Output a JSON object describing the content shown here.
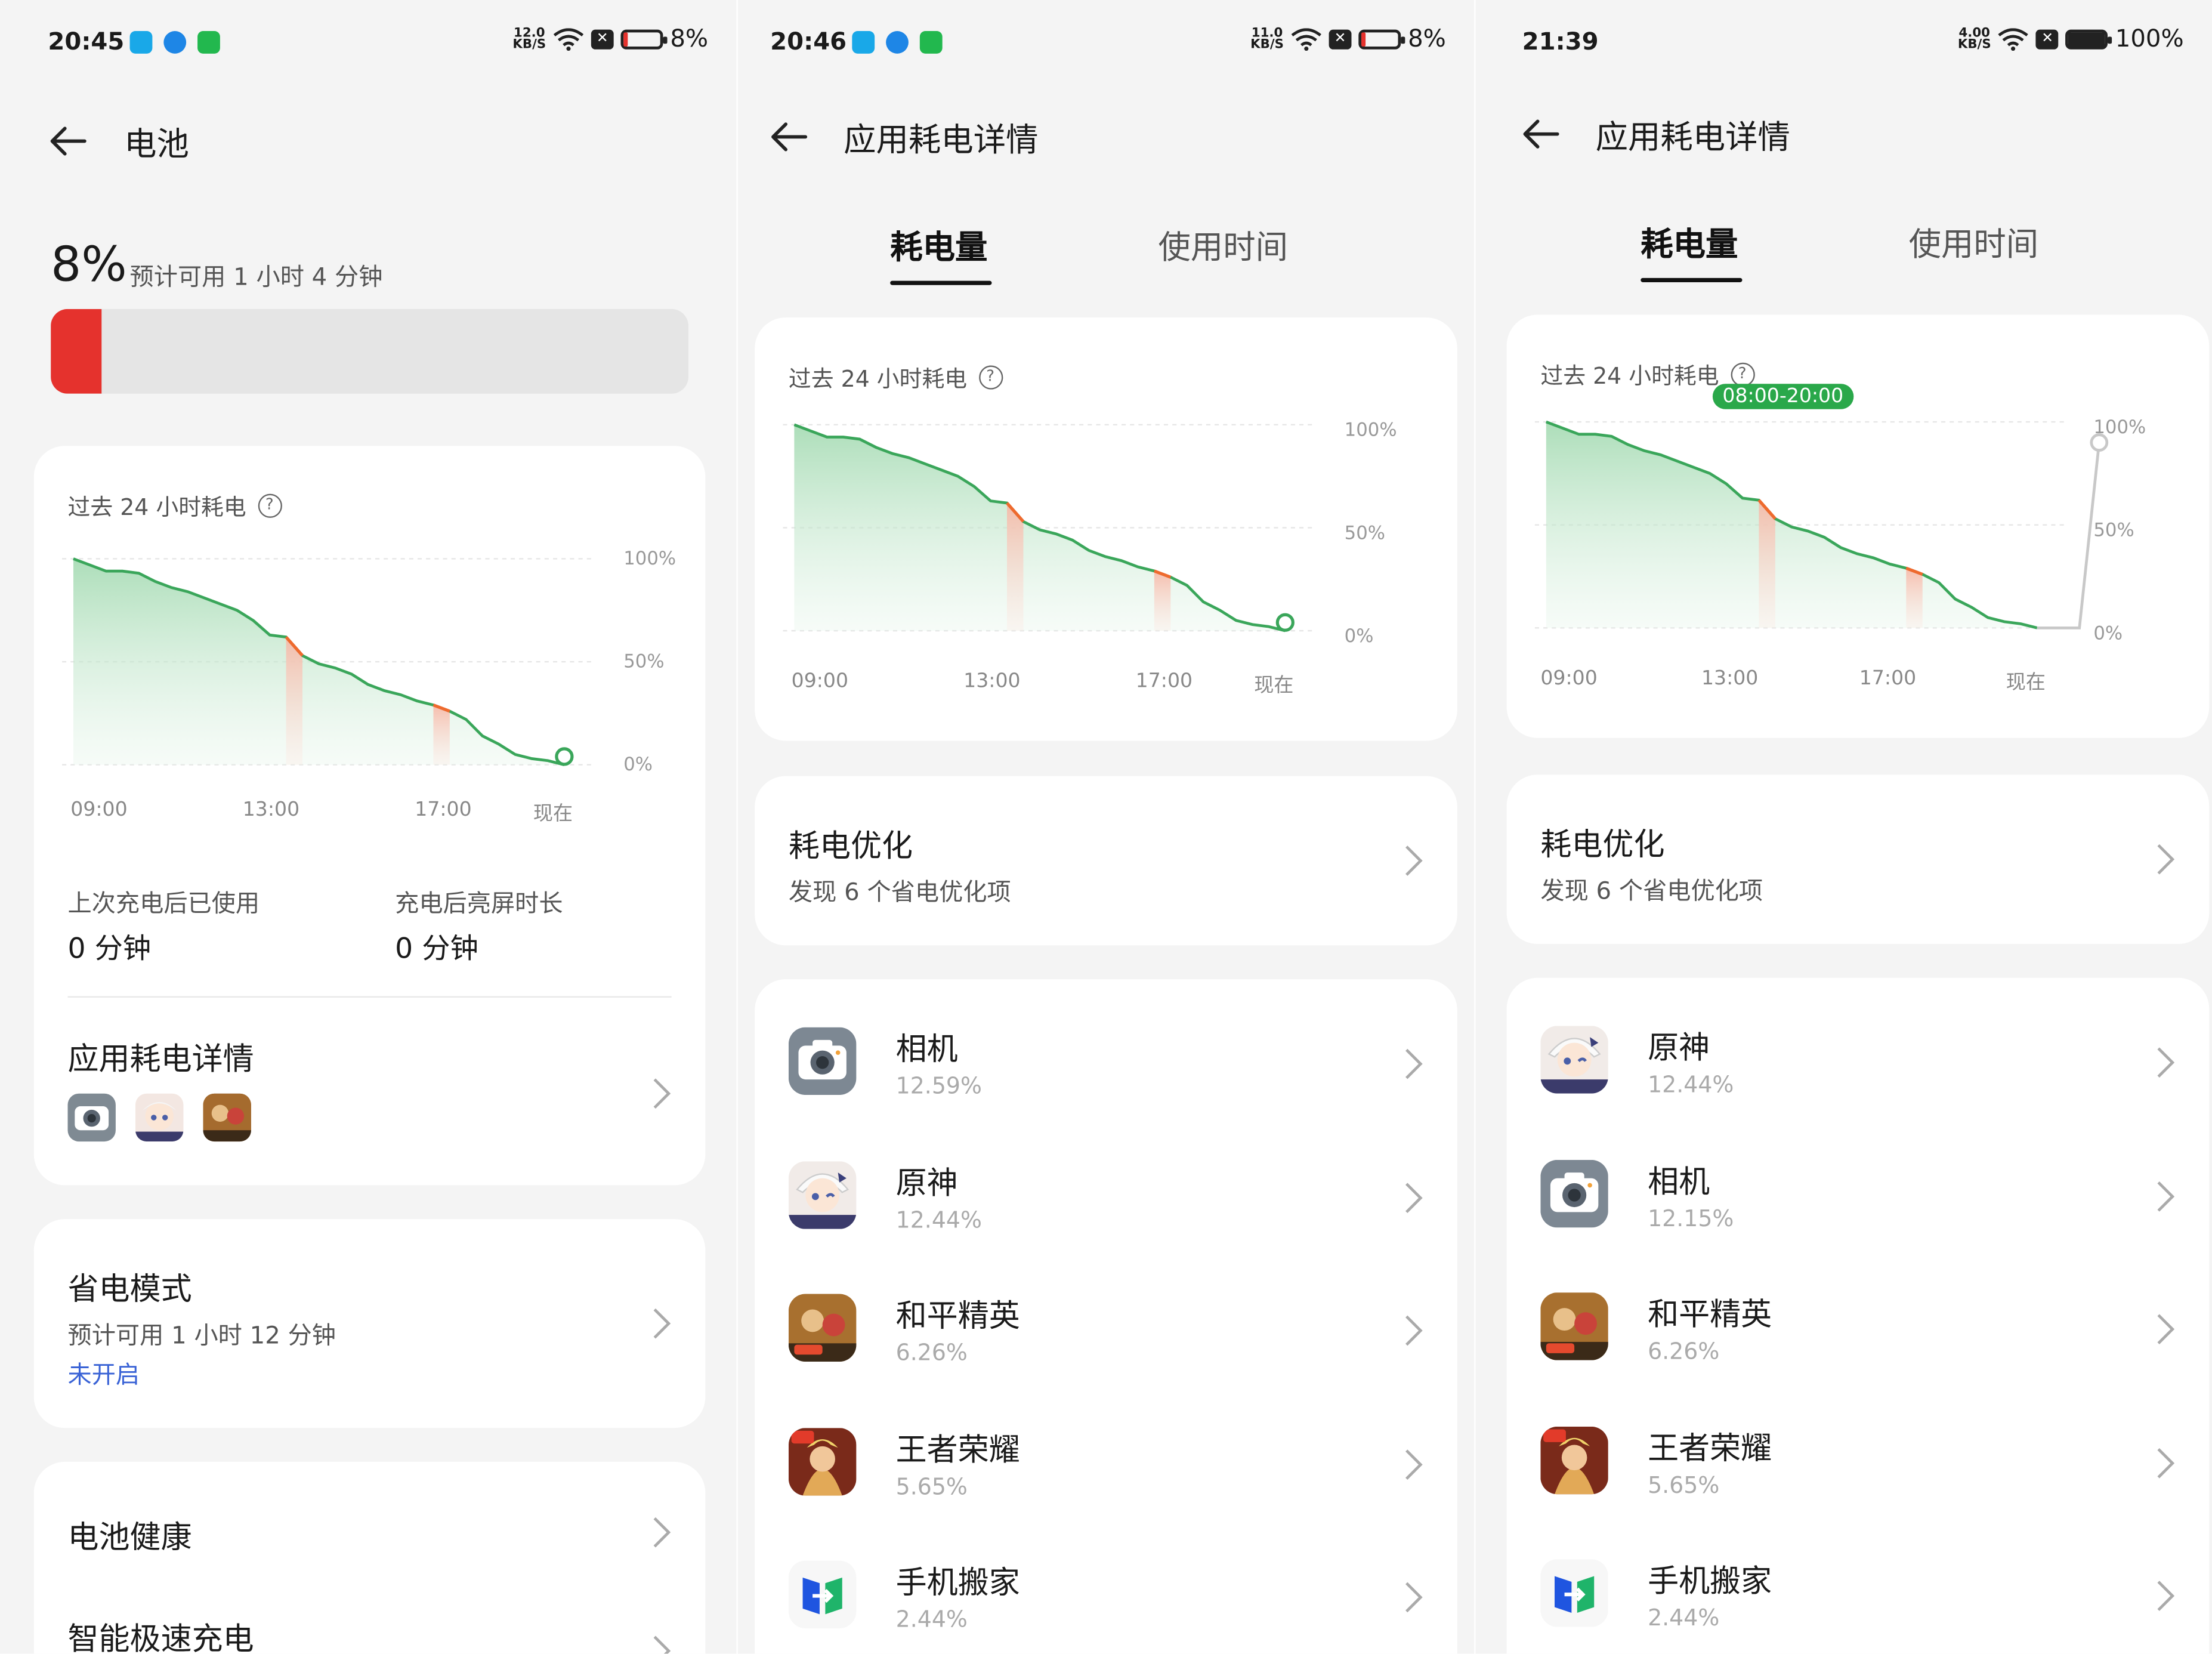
{
  "screens": [
    {
      "status": {
        "time": "20:45",
        "speed_top": "12.0",
        "speed_unit": "KB/S",
        "battery": "8%"
      },
      "header_title": "电池",
      "battery_percent": "8%",
      "estimate": "预计可用 1 小时 4 分钟",
      "battery_level": 0.08,
      "chart_title": "过去 24 小时耗电",
      "y_labels": [
        "100%",
        "50%",
        "0%"
      ],
      "x_labels": [
        "09:00",
        "13:00",
        "17:00",
        "现在"
      ],
      "stats": [
        {
          "label": "上次充电后已使用",
          "value": "0 分钟"
        },
        {
          "label": "充电后亮屏时长",
          "value": "0 分钟"
        }
      ],
      "app_detail_title": "应用耗电详情",
      "power_save": {
        "title": "省电模式",
        "sub": "预计可用 1 小时 12 分钟",
        "status": "未开启"
      },
      "battery_health": "电池健康",
      "smart_charge": "智能极速充电"
    },
    {
      "status": {
        "time": "20:46",
        "speed_top": "11.0",
        "speed_unit": "KB/S",
        "battery": "8%"
      },
      "header_title": "应用耗电详情",
      "tabs": [
        "耗电量",
        "使用时间"
      ],
      "chart_title": "过去 24 小时耗电",
      "y_labels": [
        "100%",
        "50%",
        "0%"
      ],
      "x_labels": [
        "09:00",
        "13:00",
        "17:00",
        "现在"
      ],
      "opt": {
        "title": "耗电优化",
        "sub": "发现 6 个省电优化项"
      },
      "apps": [
        {
          "name": "相机",
          "pct": "12.59%",
          "icon": "camera-icon"
        },
        {
          "name": "原神",
          "pct": "12.44%",
          "icon": "genshin-icon"
        },
        {
          "name": "和平精英",
          "pct": "6.26%",
          "icon": "peace-elite-icon"
        },
        {
          "name": "王者荣耀",
          "pct": "5.65%",
          "icon": "honor-of-kings-icon"
        },
        {
          "name": "手机搬家",
          "pct": "2.44%",
          "icon": "phone-clone-icon"
        }
      ]
    },
    {
      "status": {
        "time": "21:39",
        "speed_top": "4.00",
        "speed_unit": "KB/S",
        "battery": "100%"
      },
      "header_title": "应用耗电详情",
      "tabs": [
        "耗电量",
        "使用时间"
      ],
      "chart_title": "过去 24 小时耗电",
      "tooltip": "08:00-20:00",
      "y_labels": [
        "100%",
        "50%",
        "0%"
      ],
      "x_labels": [
        "09:00",
        "13:00",
        "17:00",
        "现在"
      ],
      "opt": {
        "title": "耗电优化",
        "sub": "发现 6 个省电优化项"
      },
      "apps": [
        {
          "name": "原神",
          "pct": "12.44%",
          "icon": "genshin-icon"
        },
        {
          "name": "相机",
          "pct": "12.15%",
          "icon": "camera-icon"
        },
        {
          "name": "和平精英",
          "pct": "6.26%",
          "icon": "peace-elite-icon"
        },
        {
          "name": "王者荣耀",
          "pct": "5.65%",
          "icon": "honor-of-kings-icon"
        },
        {
          "name": "手机搬家",
          "pct": "2.44%",
          "icon": "phone-clone-icon"
        }
      ]
    }
  ],
  "chart_data": [
    {
      "type": "area",
      "x": [
        0,
        0.4,
        0.8,
        1.2,
        1.6,
        2,
        2.4,
        2.8,
        3.2,
        3.6,
        4,
        4.4,
        4.8,
        5.2,
        5.6,
        6,
        6.4,
        6.8,
        7.2,
        7.6,
        8,
        8.4,
        8.8,
        9.2,
        9.6,
        10,
        10.4,
        10.8,
        11.2,
        11.6,
        12
      ],
      "values": [
        100,
        97,
        94,
        94,
        93,
        89,
        86,
        84,
        81,
        78,
        75,
        70,
        63,
        62,
        53,
        49,
        47,
        44,
        39,
        36,
        34,
        31,
        29,
        26,
        22,
        14,
        10,
        5,
        3,
        2,
        0
      ],
      "ylim": [
        0,
        100
      ],
      "y_tick_labels": [
        "100%",
        "50%",
        "0%"
      ],
      "x_tick_labels": [
        "09:00",
        "13:00",
        "17:00",
        "现在"
      ],
      "drop_segments": [
        [
          5.2,
          5.6
        ],
        [
          8.8,
          9.2
        ]
      ],
      "end_point": 4
    },
    {
      "type": "area",
      "x": [
        0,
        0.4,
        0.8,
        1.2,
        1.6,
        2,
        2.4,
        2.8,
        3.2,
        3.6,
        4,
        4.4,
        4.8,
        5.2,
        5.6,
        6,
        6.4,
        6.8,
        7.2,
        7.6,
        8,
        8.4,
        8.8,
        9.2,
        9.6,
        10,
        10.4,
        10.8,
        11.2,
        11.6,
        12
      ],
      "values": [
        100,
        97,
        94,
        94,
        93,
        89,
        86,
        84,
        81,
        78,
        75,
        70,
        63,
        62,
        53,
        49,
        47,
        44,
        39,
        36,
        34,
        31,
        29,
        26,
        22,
        14,
        10,
        5,
        3,
        2,
        0
      ],
      "ylim": [
        0,
        100
      ],
      "y_tick_labels": [
        "100%",
        "50%",
        "0%"
      ],
      "x_tick_labels": [
        "09:00",
        "13:00",
        "17:00",
        "现在"
      ],
      "drop_segments": [
        [
          5.2,
          5.6
        ],
        [
          8.8,
          9.2
        ]
      ],
      "end_point": 4
    },
    {
      "type": "area",
      "x": [
        0,
        0.4,
        0.8,
        1.2,
        1.6,
        2,
        2.4,
        2.8,
        3.2,
        3.6,
        4,
        4.4,
        4.8,
        5.2,
        5.6,
        6,
        6.4,
        6.8,
        7.2,
        7.6,
        8,
        8.4,
        8.8,
        9.2,
        9.6,
        10,
        10.4,
        10.8,
        11.2,
        11.6,
        12
      ],
      "values": [
        100,
        97,
        94,
        94,
        93,
        89,
        86,
        84,
        81,
        78,
        75,
        70,
        63,
        62,
        53,
        49,
        47,
        44,
        39,
        36,
        34,
        31,
        29,
        26,
        22,
        14,
        10,
        5,
        3,
        2,
        0
      ],
      "ylim": [
        0,
        100
      ],
      "y_tick_labels": [
        "100%",
        "50%",
        "0%"
      ],
      "x_tick_labels": [
        "09:00",
        "13:00",
        "17:00",
        "现在"
      ],
      "drop_segments": [
        [
          5.2,
          5.6
        ],
        [
          8.8,
          9.2
        ]
      ],
      "charge_tail": [
        0,
        90
      ],
      "end_point": 90
    }
  ],
  "colors": {
    "accent_green": "#3aa65a",
    "drain_orange": "#ee6a2e",
    "battery_red": "#e5322d",
    "link_blue": "#3a63d6"
  }
}
